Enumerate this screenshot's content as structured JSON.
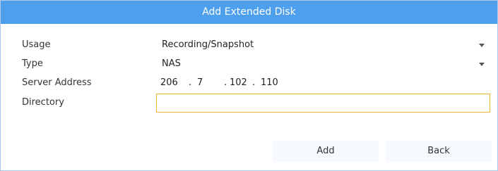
{
  "dialog": {
    "title": "Add Extended Disk"
  },
  "form": {
    "usage": {
      "label": "Usage",
      "value": "Recording/Snapshot"
    },
    "type": {
      "label": "Type",
      "value": "NAS"
    },
    "server_address": {
      "label": "Server Address",
      "octets": [
        "206",
        "7",
        "102",
        "110"
      ],
      "separator": "."
    },
    "directory": {
      "label": "Directory",
      "value": ""
    }
  },
  "buttons": {
    "add_label": "Add",
    "back_label": "Back"
  },
  "colors": {
    "title_bar": "#4ea0ec",
    "focus_border": "#f0b33a"
  }
}
